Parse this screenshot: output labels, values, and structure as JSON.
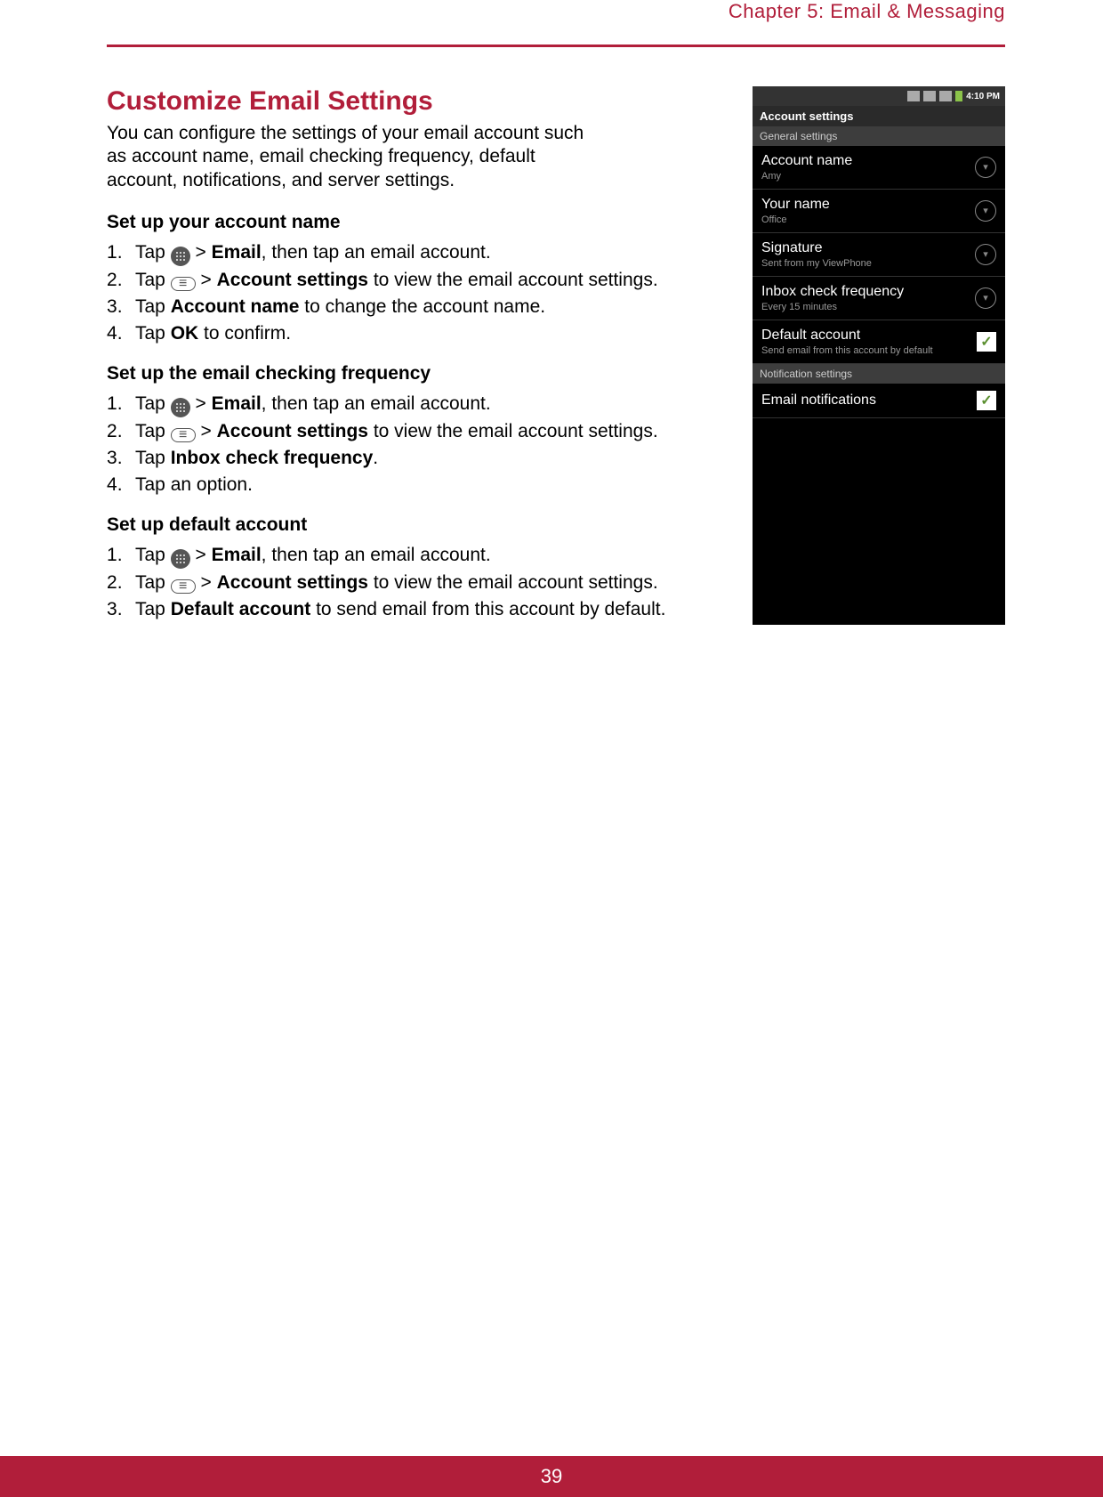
{
  "chapter": "Chapter 5: Email & Messaging",
  "page_number": "39",
  "title": "Customize Email Settings",
  "intro": "You can configure the settings of your email account such as account name, email checking frequency, default account, notifications, and server settings.",
  "sections": [
    {
      "heading": "Set up your account name",
      "steps": [
        {
          "pre": "Tap ",
          "icon": "apps",
          "mid": " > ",
          "bold1": "Email",
          "post": ", then tap an email account."
        },
        {
          "pre": "Tap ",
          "icon": "menu",
          "mid": " > ",
          "bold1": "Account settings",
          "post": " to view the email account settings."
        },
        {
          "pre": "Tap ",
          "bold1": "Account name",
          "post": " to change the account name."
        },
        {
          "pre": "Tap ",
          "bold1": "OK",
          "post": " to confirm."
        }
      ]
    },
    {
      "heading": "Set up the email checking frequency",
      "steps": [
        {
          "pre": "Tap ",
          "icon": "apps",
          "mid": " > ",
          "bold1": "Email",
          "post": ", then tap an email account."
        },
        {
          "pre": "Tap ",
          "icon": "menu",
          "mid": " > ",
          "bold1": "Account settings",
          "post": " to view the email account settings."
        },
        {
          "pre": "Tap ",
          "bold1": "Inbox check frequency",
          "post": "."
        },
        {
          "pre": "Tap an option."
        }
      ]
    },
    {
      "heading": "Set up default account",
      "wide": true,
      "steps": [
        {
          "pre": "Tap ",
          "icon": "apps",
          "mid": " > ",
          "bold1": "Email",
          "post": ", then tap an email account."
        },
        {
          "pre": "Tap ",
          "icon": "menu",
          "mid": " > ",
          "bold1": "Account settings",
          "post": " to view the email account settings."
        },
        {
          "pre": "Tap ",
          "bold1": "Default account",
          "post": " to send email from this account by default."
        }
      ]
    }
  ],
  "phone": {
    "time": "4:10 PM",
    "title": "Account settings",
    "section1": "General settings",
    "rows": [
      {
        "title": "Account name",
        "sub": "Amy",
        "ctrl": "chevron"
      },
      {
        "title": "Your name",
        "sub": "Office",
        "ctrl": "chevron"
      },
      {
        "title": "Signature",
        "sub": "Sent from my ViewPhone",
        "ctrl": "chevron"
      },
      {
        "title": "Inbox check frequency",
        "sub": "Every 15 minutes",
        "ctrl": "chevron"
      },
      {
        "title": "Default account",
        "sub": "Send email from this account by default",
        "ctrl": "check"
      }
    ],
    "section2": "Notification settings",
    "rows2": [
      {
        "title": "Email notifications",
        "sub": "",
        "ctrl": "check"
      }
    ]
  }
}
